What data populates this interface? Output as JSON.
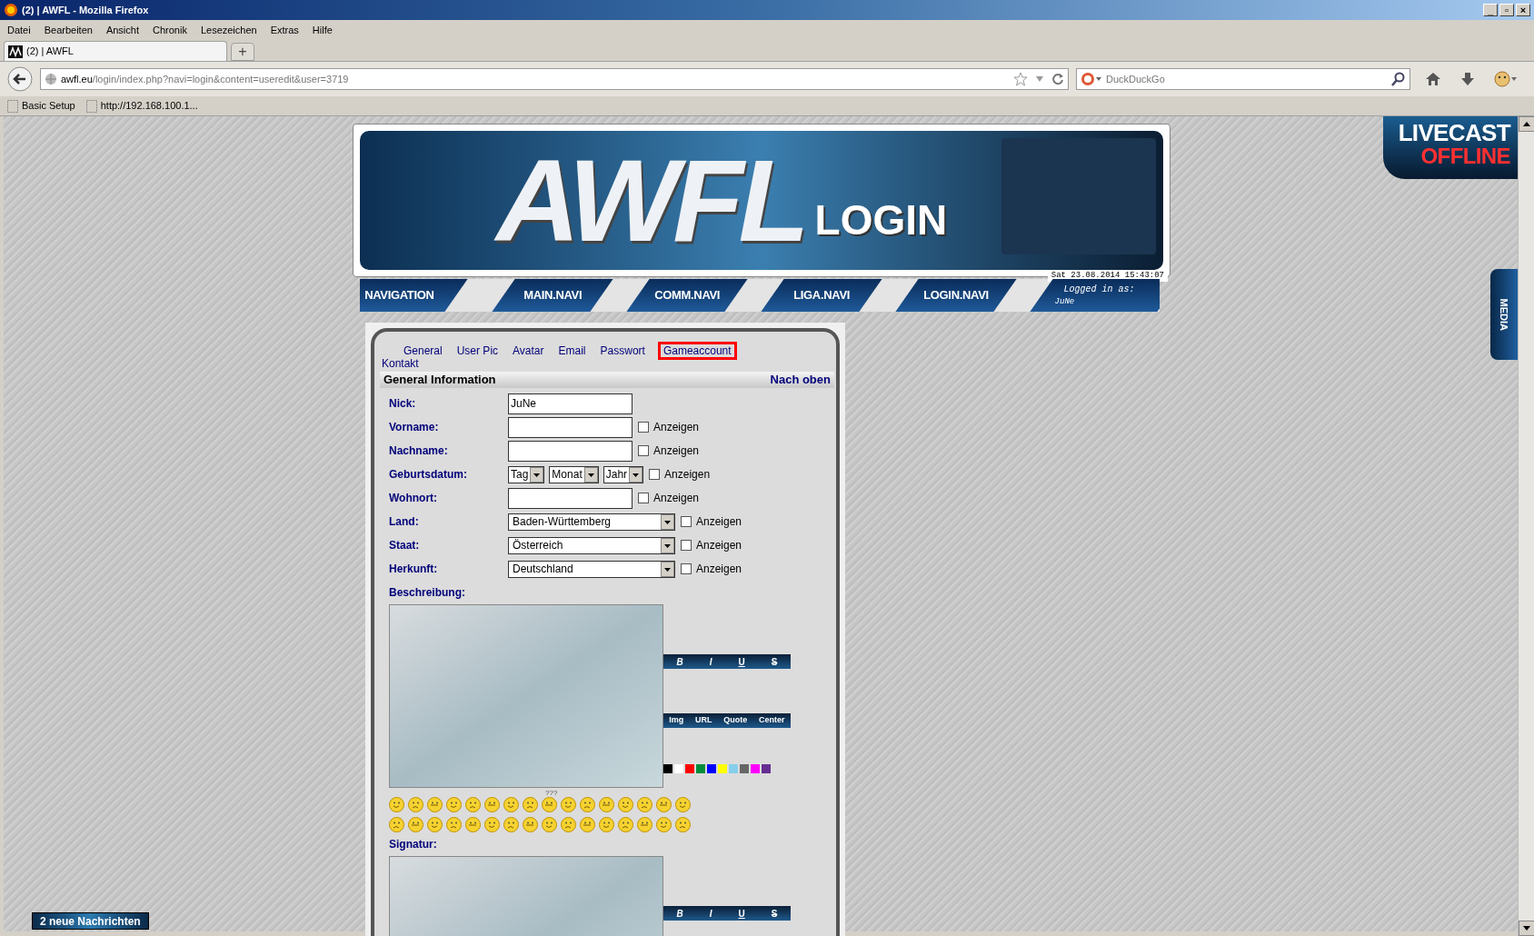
{
  "browser": {
    "window_title": "(2) | AWFL - Mozilla Firefox",
    "window_buttons": [
      "_",
      "▫",
      "×"
    ],
    "menu": [
      "Datei",
      "Bearbeiten",
      "Ansicht",
      "Chronik",
      "Lesezeichen",
      "Extras",
      "Hilfe"
    ],
    "tabs": [
      {
        "title": "(2) | AWFL",
        "selected": true
      }
    ],
    "new_tab": "+",
    "url_host": "awfl.eu",
    "url_path": "/login/index.php?navi=login&content=useredit&user=3719",
    "search_placeholder": "DuckDuckGo",
    "bookmarks": [
      "Basic Setup",
      "http://192.168.100.1..."
    ]
  },
  "banner": {
    "logo": "AWFL",
    "subtitle": "LOGIN",
    "datetime": "Sat 23.08.2014 15:43:07"
  },
  "nav": {
    "items": [
      "NAVIGATION",
      "MAIN.NAVI",
      "COMM.NAVI",
      "LIGA.NAVI",
      "LOGIN.NAVI"
    ],
    "logged_in_label": "Logged in as:",
    "user": "JuNe"
  },
  "tabs": [
    {
      "label": "General",
      "selected": false
    },
    {
      "label": "User Pic",
      "selected": false
    },
    {
      "label": "Avatar",
      "selected": false
    },
    {
      "label": "Email",
      "selected": false
    },
    {
      "label": "Passwort",
      "selected": false
    },
    {
      "label": "Gameaccount",
      "selected": true
    },
    {
      "label": "Kontakt",
      "selected": false
    }
  ],
  "section": {
    "title": "General Information",
    "link": "Nach oben"
  },
  "fields": [
    {
      "kind": "text",
      "label": "Nick:",
      "value": "JuNe"
    },
    {
      "kind": "text",
      "label": "Vorname:",
      "show": {
        "label": "Anzeigen",
        "checked": false
      }
    },
    {
      "kind": "text",
      "label": "Nachname:",
      "show": {
        "label": "Anzeigen",
        "checked": false
      }
    },
    {
      "kind": "date",
      "label": "Geburtsdatum:",
      "selects": [
        "Tag",
        "Monat",
        "Jahr"
      ],
      "show": {
        "label": "Anzeigen",
        "checked": false
      }
    },
    {
      "kind": "text",
      "label": "Wohnort:",
      "show": {
        "label": "Anzeigen",
        "checked": false
      }
    },
    {
      "kind": "select",
      "label": "Land:",
      "value": "Baden-Württemberg",
      "show": {
        "label": "Anzeigen",
        "checked": false
      }
    },
    {
      "kind": "select",
      "label": "Staat:",
      "value": "Österreich",
      "show": {
        "label": "Anzeigen",
        "checked": false
      }
    },
    {
      "kind": "select",
      "label": "Herkunft:",
      "value": "Deutschland",
      "show": {
        "label": "Anzeigen",
        "checked": false
      }
    }
  ],
  "description": {
    "label": "Beschreibung:",
    "format_buttons": [
      "B",
      "I",
      "U",
      "S"
    ],
    "insert_buttons": [
      "Img",
      "URL",
      "Quote",
      "Center"
    ],
    "colors": [
      {
        "color": "#000000"
      },
      {
        "color": "#ffffff"
      },
      {
        "color": "#ff0000"
      },
      {
        "color": "#008c3a"
      },
      {
        "color": "#0000ff"
      },
      {
        "color": "#ffff00"
      },
      {
        "color": "#87ceeb"
      },
      {
        "color": "#666666"
      },
      {
        "color": "#ff00ff"
      },
      {
        "color": "#662d91"
      }
    ],
    "smiley_caption": "???"
  },
  "signature": {
    "label": "Signatur:",
    "format_buttons": [
      "B",
      "I",
      "U",
      "S"
    ]
  },
  "new_messages": "2 neue Nachrichten",
  "livecast": {
    "title": "LIVECAST",
    "status": "OFFLINE"
  },
  "media_tab": "MEDIA"
}
